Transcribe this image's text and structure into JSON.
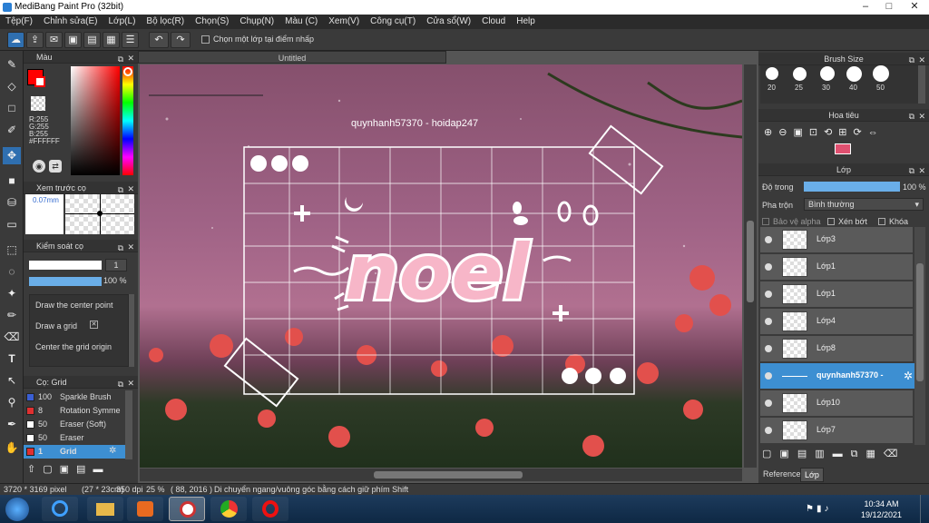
{
  "window": {
    "title": "MediBang Paint Pro (32bit)"
  },
  "menu": [
    "Tệp(F)",
    "Chỉnh sửa(E)",
    "Lớp(L)",
    "Bộ lọc(R)",
    "Chọn(S)",
    "Chụp(N)",
    "Màu (C)",
    "Xem(V)",
    "Công cụ(T)",
    "Cửa sổ(W)",
    "Cloud",
    "Help"
  ],
  "toolbar": {
    "option_label": "Chọn một lớp tại điểm nhấp"
  },
  "color_panel": {
    "title": "Màu",
    "r": "R:255",
    "g": "G:255",
    "b": "B:255",
    "hex": "#FFFFFF",
    "primary": "#ff0000",
    "secondary": "#ffffff"
  },
  "brush_preview": {
    "title": "Xem trước cọ",
    "size": "0.07mm"
  },
  "brush_control": {
    "title": "Kiểm soát cọ",
    "width": "1",
    "opacity": "100 %",
    "items": [
      "Draw the center point",
      "Draw a grid",
      "Center the grid origin"
    ]
  },
  "brush_list": {
    "title": "Cọ: Grid",
    "items": [
      {
        "size": "100",
        "name": "Sparkle Brush",
        "color": "#3a5fd4"
      },
      {
        "size": "8",
        "name": "Rotation Symme",
        "color": "#e03030"
      },
      {
        "size": "50",
        "name": "Eraser (Soft)",
        "color": "#ffffff"
      },
      {
        "size": "50",
        "name": "Eraser",
        "color": "#ffffff"
      },
      {
        "size": "1",
        "name": "Grid",
        "color": "#e03030"
      }
    ]
  },
  "canvas": {
    "tab": "Untitled",
    "watermark": "quynhanh57370 - hoidap247",
    "word": "noel"
  },
  "brush_size": {
    "title": "Brush Size",
    "values": [
      "20",
      "25",
      "30",
      "40",
      "50"
    ]
  },
  "navigator": {
    "title": "Hoa tiêu"
  },
  "layer_panel": {
    "title": "Lớp",
    "opacity_label": "Độ trong",
    "opacity": "100 %",
    "blend_label": "Pha trộn",
    "blend": "Bình thường",
    "alpha": "Bảo vệ alpha",
    "clip": "Xén bớt",
    "lock": "Khóa"
  },
  "layers": [
    {
      "name": "Lớp3"
    },
    {
      "name": "Lớp1"
    },
    {
      "name": "Lớp1"
    },
    {
      "name": "Lớp4"
    },
    {
      "name": "Lớp8"
    },
    {
      "name": "quynhanh57370 -"
    },
    {
      "name": "Lớp10"
    },
    {
      "name": "Lớp7"
    }
  ],
  "right_tabs": [
    "Reference",
    "Lớp"
  ],
  "status": {
    "size": "3720 * 3169 pixel",
    "cm": "(27 * 23cm)",
    "dpi": "350 dpi",
    "zoom": "25 %",
    "pos": "( 88, 2016 )",
    "hint": "Di chuyển ngang/vuông góc bằng cách giữ phím Shift"
  },
  "clock": {
    "time": "10:34 AM",
    "date": "19/12/2021"
  }
}
